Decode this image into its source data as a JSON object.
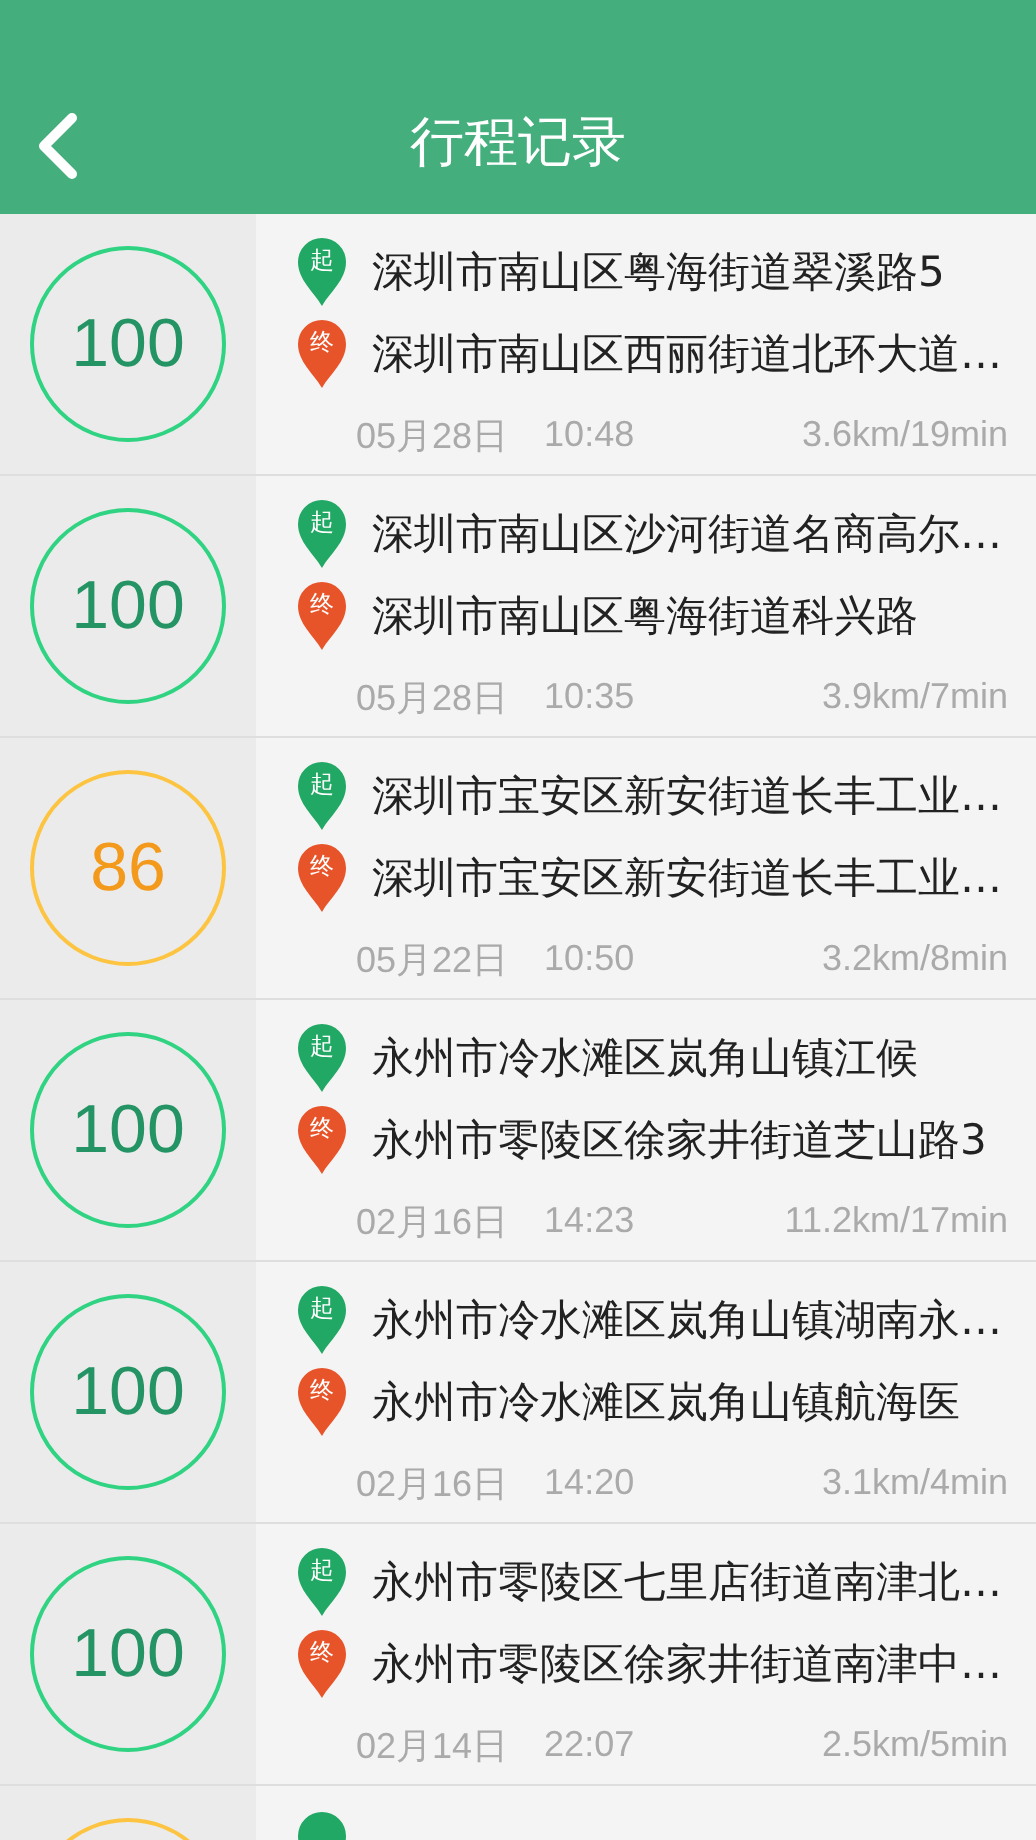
{
  "header": {
    "title": "行程记录"
  },
  "trips": [
    {
      "score": "100",
      "color": "#30d382",
      "start": {
        "tag": "起",
        "address": "深圳市南山区粤海街道翠溪路5"
      },
      "end": {
        "tag": "终",
        "address": "深圳市南山区西丽街道北环大道…"
      },
      "date": "05月28日",
      "time": "10:48",
      "distance": "3.6km/19min"
    },
    {
      "score": "100",
      "color": "#30d382",
      "start": {
        "tag": "起",
        "address": "深圳市南山区沙河街道名商高尔…"
      },
      "end": {
        "tag": "终",
        "address": "深圳市南山区粤海街道科兴路"
      },
      "date": "05月28日",
      "time": "10:35",
      "distance": "3.9km/7min"
    },
    {
      "score": "86",
      "color": "#fdc441",
      "start": {
        "tag": "起",
        "address": "深圳市宝安区新安街道长丰工业…"
      },
      "end": {
        "tag": "终",
        "address": "深圳市宝安区新安街道长丰工业…"
      },
      "date": "05月22日",
      "time": "10:50",
      "distance": "3.2km/8min"
    },
    {
      "score": "100",
      "color": "#30d382",
      "start": {
        "tag": "起",
        "address": "永州市冷水滩区岚角山镇江候"
      },
      "end": {
        "tag": "终",
        "address": "永州市零陵区徐家井街道芝山路3"
      },
      "date": "02月16日",
      "time": "14:23",
      "distance": "11.2km/17min"
    },
    {
      "score": "100",
      "color": "#30d382",
      "start": {
        "tag": "起",
        "address": "永州市冷水滩区岚角山镇湖南永…"
      },
      "end": {
        "tag": "终",
        "address": "永州市冷水滩区岚角山镇航海医"
      },
      "date": "02月16日",
      "time": "14:20",
      "distance": "3.1km/4min"
    },
    {
      "score": "100",
      "color": "#30d382",
      "start": {
        "tag": "起",
        "address": "永州市零陵区七里店街道南津北…"
      },
      "end": {
        "tag": "终",
        "address": "永州市零陵区徐家井街道南津中…"
      },
      "date": "02月14日",
      "time": "22:07",
      "distance": "2.5km/5min"
    },
    {
      "color": "#fdc441"
    }
  ]
}
